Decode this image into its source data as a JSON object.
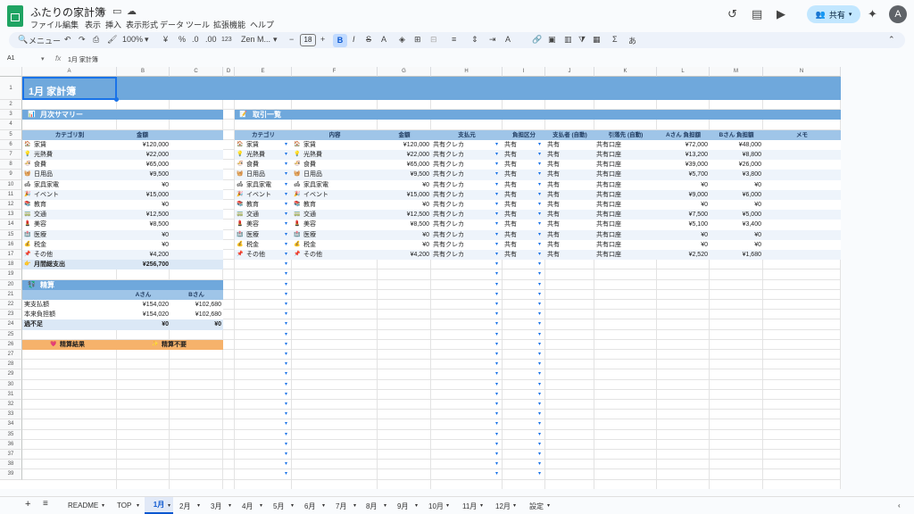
{
  "app": {
    "title": "ふたりの家計簿",
    "menu": [
      "ファイル",
      "編集",
      "表示",
      "挿入",
      "表示形式",
      "データ",
      "ツール",
      "拡張機能",
      "ヘルプ"
    ],
    "share_label": "共有",
    "avatar": "A"
  },
  "toolbar": {
    "search": "メニュー",
    "zoom": "100%",
    "currency": "¥",
    "percent": "%",
    "dec1": ".0",
    "dec2": ".00",
    "num_format": "123",
    "font": "Zen M...",
    "font_size": "18",
    "bold": "B",
    "italic": "I",
    "input_tool": "あ"
  },
  "formula_bar": {
    "cell": "A1",
    "fx": "fx",
    "content": "1月 家計簿"
  },
  "columns": [
    "A",
    "B",
    "C",
    "D",
    "E",
    "F",
    "G",
    "H",
    "I",
    "J",
    "K",
    "L",
    "M",
    "N"
  ],
  "rows": [
    "1",
    "2",
    "3",
    "4",
    "5",
    "6",
    "7",
    "8",
    "9",
    "10",
    "11",
    "12",
    "13",
    "14",
    "15",
    "16",
    "17",
    "18",
    "19",
    "20",
    "21",
    "22",
    "23",
    "24",
    "25",
    "26",
    "27",
    "28",
    "29",
    "30",
    "31",
    "32",
    "33",
    "34",
    "35",
    "36",
    "37",
    "38",
    "39"
  ],
  "sheet": {
    "title": "1月 家計簿",
    "summary": {
      "section_title": "月次サマリー",
      "header_category": "カテゴリ別",
      "header_amount": "金額",
      "rows": [
        {
          "icon": "🏠",
          "cat": "家賃",
          "amt": "¥120,000"
        },
        {
          "icon": "💡",
          "cat": "光熱費",
          "amt": "¥22,000"
        },
        {
          "icon": "🍜",
          "cat": "食費",
          "amt": "¥65,000"
        },
        {
          "icon": "🧺",
          "cat": "日用品",
          "amt": "¥9,500"
        },
        {
          "icon": "🛋",
          "cat": "家具家電",
          "amt": "¥0"
        },
        {
          "icon": "🎉",
          "cat": "イベント",
          "amt": "¥15,000"
        },
        {
          "icon": "📚",
          "cat": "教育",
          "amt": "¥0"
        },
        {
          "icon": "🚃",
          "cat": "交通",
          "amt": "¥12,500"
        },
        {
          "icon": "💄",
          "cat": "美容",
          "amt": "¥8,500"
        },
        {
          "icon": "🏥",
          "cat": "医療",
          "amt": "¥0"
        },
        {
          "icon": "💰",
          "cat": "税金",
          "amt": "¥0"
        },
        {
          "icon": "📌",
          "cat": "その他",
          "amt": "¥4,200"
        }
      ],
      "total_label": "月間総支出",
      "total": "¥256,700"
    },
    "settlement": {
      "section_title": "精算",
      "col_a": "Aさん",
      "col_b": "Bさん",
      "rows": [
        {
          "label": "実支払額",
          "a": "¥154,020",
          "b": "¥102,680"
        },
        {
          "label": "本来負担額",
          "a": "¥154,020",
          "b": "¥102,680"
        },
        {
          "label": "過不足",
          "a": "¥0",
          "b": "¥0"
        }
      ],
      "result_label": "精算結果",
      "result_value": "精算不要"
    },
    "transactions": {
      "section_title": "取引一覧",
      "headers": [
        "カテゴリ",
        "内容",
        "金額",
        "支払元",
        "負担区分",
        "支払者 (自動)",
        "引落先 (自動)",
        "Aさん 負担額",
        "Bさん 負担額",
        "メモ"
      ],
      "rows": [
        {
          "icon": "🏠",
          "cat": "家賃",
          "desc": "家賃",
          "amt": "¥120,000",
          "src": "共有クレカ",
          "share": "共有",
          "payer": "共有",
          "dest": "共有口座",
          "a": "¥72,000",
          "b": "¥48,000"
        },
        {
          "icon": "💡",
          "cat": "光熱費",
          "desc": "光熱費",
          "amt": "¥22,000",
          "src": "共有クレカ",
          "share": "共有",
          "payer": "共有",
          "dest": "共有口座",
          "a": "¥13,200",
          "b": "¥8,800"
        },
        {
          "icon": "🍜",
          "cat": "食費",
          "desc": "食費",
          "amt": "¥65,000",
          "src": "共有クレカ",
          "share": "共有",
          "payer": "共有",
          "dest": "共有口座",
          "a": "¥39,000",
          "b": "¥26,000"
        },
        {
          "icon": "🧺",
          "cat": "日用品",
          "desc": "日用品",
          "amt": "¥9,500",
          "src": "共有クレカ",
          "share": "共有",
          "payer": "共有",
          "dest": "共有口座",
          "a": "¥5,700",
          "b": "¥3,800"
        },
        {
          "icon": "🛋",
          "cat": "家具家電",
          "desc": "家具家電",
          "amt": "¥0",
          "src": "共有クレカ",
          "share": "共有",
          "payer": "共有",
          "dest": "共有口座",
          "a": "¥0",
          "b": "¥0"
        },
        {
          "icon": "🎉",
          "cat": "イベント",
          "desc": "イベント",
          "amt": "¥15,000",
          "src": "共有クレカ",
          "share": "共有",
          "payer": "共有",
          "dest": "共有口座",
          "a": "¥9,000",
          "b": "¥6,000"
        },
        {
          "icon": "📚",
          "cat": "教育",
          "desc": "教育",
          "amt": "¥0",
          "src": "共有クレカ",
          "share": "共有",
          "payer": "共有",
          "dest": "共有口座",
          "a": "¥0",
          "b": "¥0"
        },
        {
          "icon": "🚃",
          "cat": "交通",
          "desc": "交通",
          "amt": "¥12,500",
          "src": "共有クレカ",
          "share": "共有",
          "payer": "共有",
          "dest": "共有口座",
          "a": "¥7,500",
          "b": "¥5,000"
        },
        {
          "icon": "💄",
          "cat": "美容",
          "desc": "美容",
          "amt": "¥8,500",
          "src": "共有クレカ",
          "share": "共有",
          "payer": "共有",
          "dest": "共有口座",
          "a": "¥5,100",
          "b": "¥3,400"
        },
        {
          "icon": "🏥",
          "cat": "医療",
          "desc": "医療",
          "amt": "¥0",
          "src": "共有クレカ",
          "share": "共有",
          "payer": "共有",
          "dest": "共有口座",
          "a": "¥0",
          "b": "¥0"
        },
        {
          "icon": "💰",
          "cat": "税金",
          "desc": "税金",
          "amt": "¥0",
          "src": "共有クレカ",
          "share": "共有",
          "payer": "共有",
          "dest": "共有口座",
          "a": "¥0",
          "b": "¥0"
        },
        {
          "icon": "📌",
          "cat": "その他",
          "desc": "その他",
          "amt": "¥4,200",
          "src": "共有クレカ",
          "share": "共有",
          "payer": "共有",
          "dest": "共有口座",
          "a": "¥2,520",
          "b": "¥1,680"
        }
      ]
    }
  },
  "tabs": [
    "README",
    "TOP",
    "1月",
    "2月",
    "3月",
    "4月",
    "5月",
    "6月",
    "7月",
    "8月",
    "9月",
    "10月",
    "11月",
    "12月",
    "設定"
  ],
  "colors": {
    "band": "#6fa8dc",
    "header": "#9fc5e8",
    "result": "#f6b26b",
    "result_left": "#f6b26b",
    "accent": "#0b57d0"
  }
}
